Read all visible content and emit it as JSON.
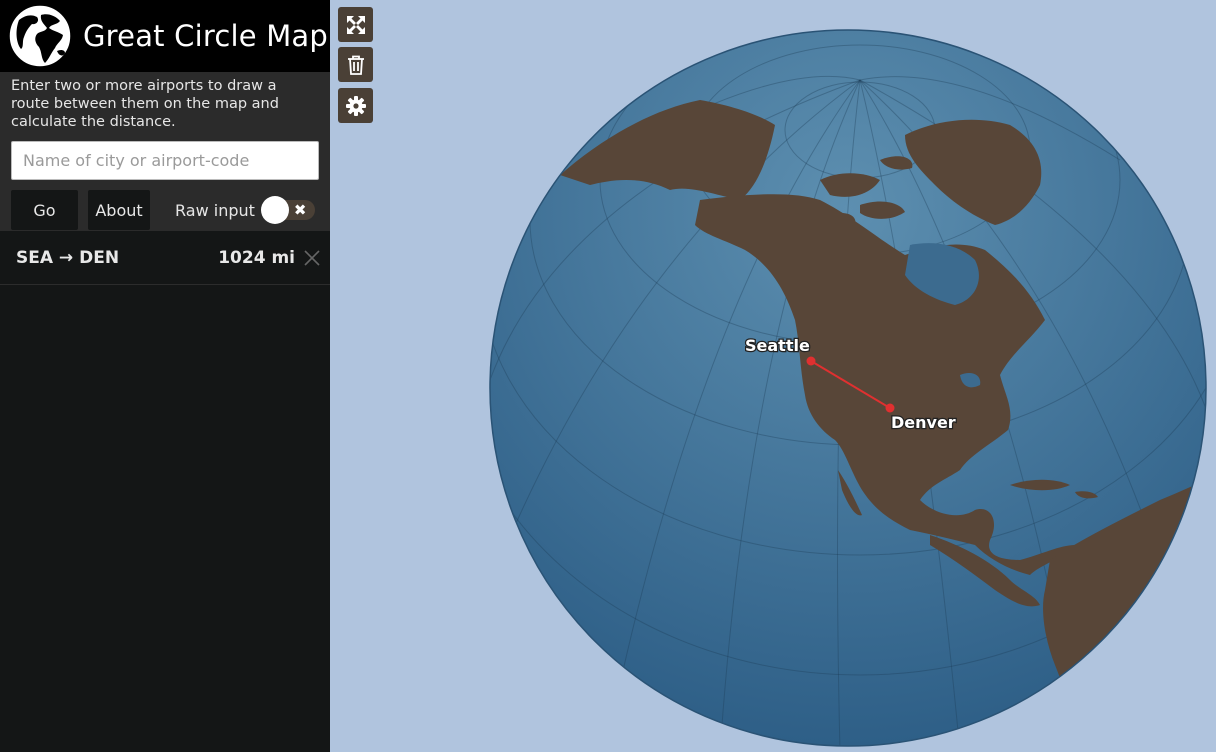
{
  "app": {
    "title": "Great Circle Map"
  },
  "panel": {
    "intro": "Enter two or more airports to draw a route between them on the map and calculate the distance.",
    "input_placeholder": "Name of city or airport-code",
    "go_label": "Go",
    "about_label": "About",
    "raw_input_label": "Raw input",
    "raw_input_on": false
  },
  "routes": [
    {
      "label": "SEA → DEN",
      "distance": "1024 mi"
    }
  ],
  "map": {
    "cities": [
      {
        "name": "Seattle",
        "code": "SEA"
      },
      {
        "name": "Denver",
        "code": "DEN"
      }
    ],
    "colors": {
      "ocean": "#2e5f87",
      "land": "#584638",
      "background": "#b0c4de",
      "route": "#e03030"
    }
  }
}
